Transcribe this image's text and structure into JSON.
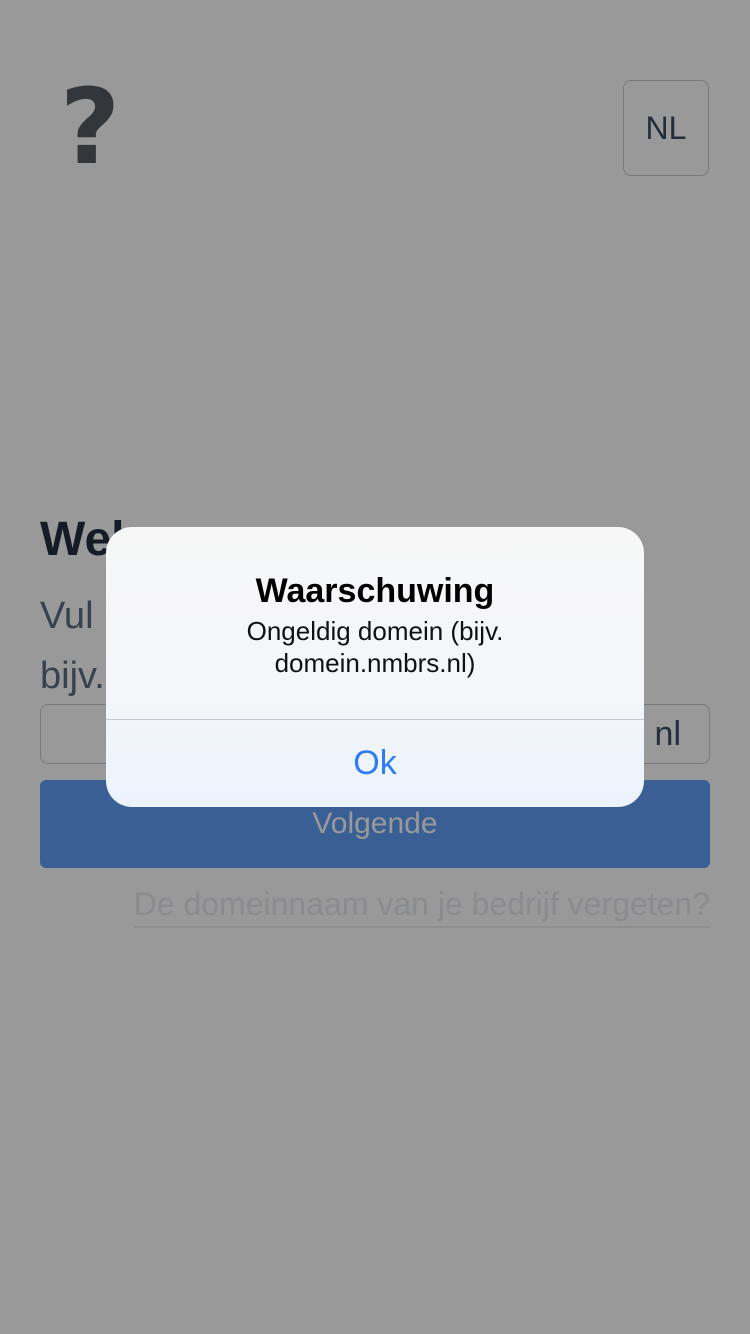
{
  "header": {
    "help_icon": "?",
    "language_label": "NL"
  },
  "login": {
    "welcome_title": "Wel",
    "instruction_text": "Vul\nbijv.",
    "domain_input_value": "",
    "domain_suffix": "nl",
    "next_button_label": "Volgende",
    "forgot_domain_link": "De domeinnaam van je bedrijf vergeten?"
  },
  "alert": {
    "title": "Waarschuwing",
    "message": "Ongeldig domein (bijv. domein.nmbrs.nl)",
    "ok_label": "Ok"
  },
  "colors": {
    "overlay": "#999999",
    "ok_text": "#2f7bf6",
    "primary_button": "#5f9ff7"
  }
}
